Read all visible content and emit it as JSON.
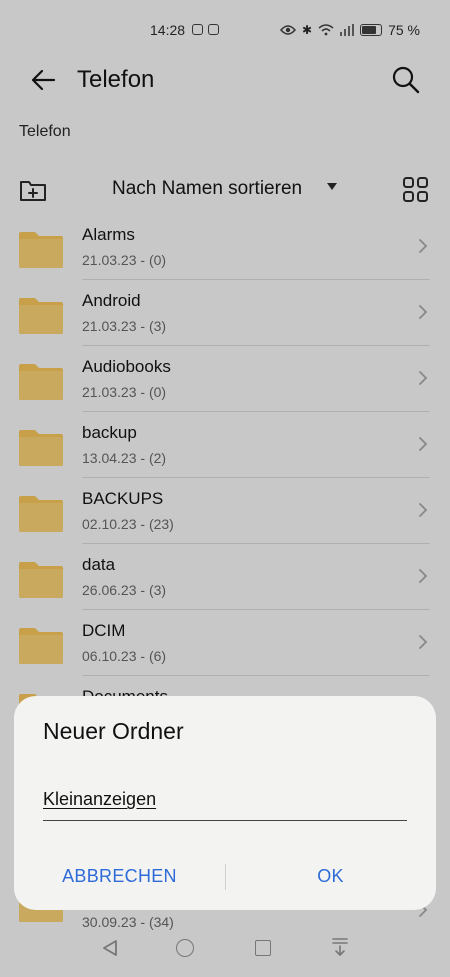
{
  "status_bar": {
    "time": "14:28",
    "battery": "75 %"
  },
  "app_bar": {
    "title": "Telefon",
    "back_icon": "arrow-left-icon",
    "search_icon": "search-icon"
  },
  "breadcrumb": "Telefon",
  "sort_bar": {
    "label": "Nach Namen sortieren",
    "new_folder_icon": "new-folder-icon",
    "grid_icon": "grid-view-icon"
  },
  "folders": [
    {
      "name": "Alarms",
      "meta": "21.03.23 - (0)"
    },
    {
      "name": "Android",
      "meta": "21.03.23 - (3)"
    },
    {
      "name": "Audiobooks",
      "meta": "21.03.23 - (0)"
    },
    {
      "name": "backup",
      "meta": "13.04.23 - (2)"
    },
    {
      "name": "BACKUPS",
      "meta": "02.10.23 - (23)"
    },
    {
      "name": "data",
      "meta": "26.06.23 - (3)"
    },
    {
      "name": "DCIM",
      "meta": "06.10.23 - (6)"
    },
    {
      "name": "Documents",
      "meta": ""
    }
  ],
  "last_visible_row": {
    "meta": "30.09.23 - (34)"
  },
  "dialog": {
    "title": "Neuer Ordner",
    "input_value": "Kleinanzeigen",
    "cancel_label": "ABBRECHEN",
    "ok_label": "OK"
  },
  "colors": {
    "folder": "#c8a04a",
    "accent": "#2f6bd8",
    "scrim": "#c8c8c8"
  }
}
